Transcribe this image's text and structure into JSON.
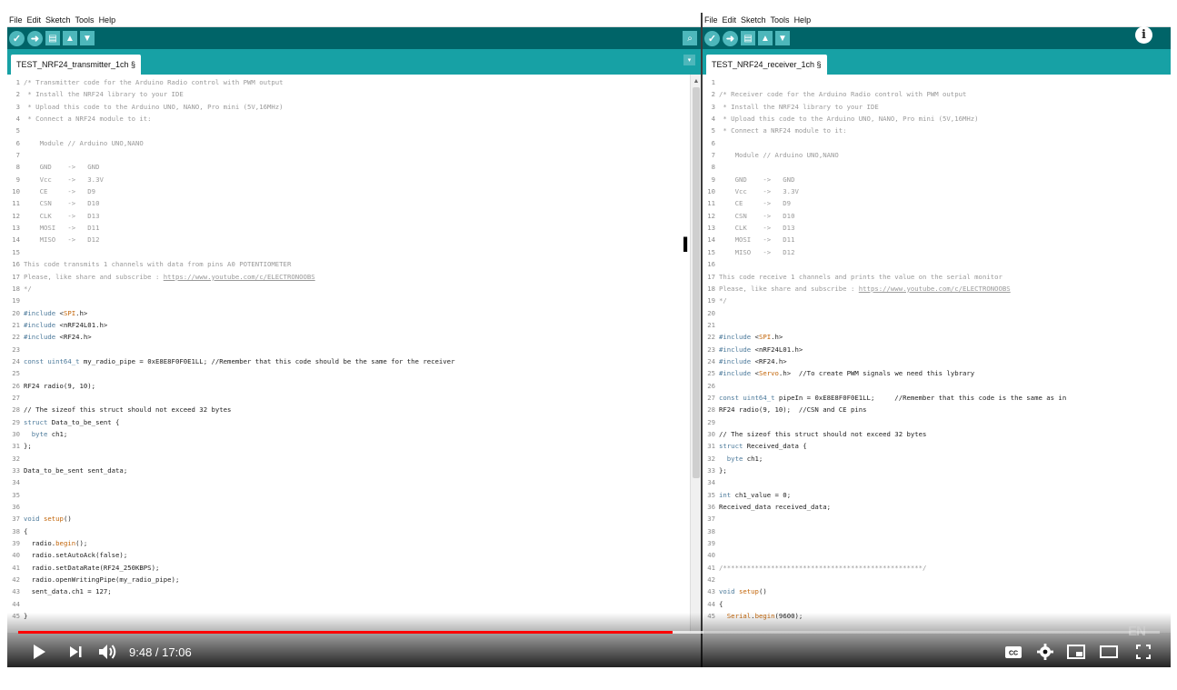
{
  "menu": [
    "File",
    "Edit",
    "Sketch",
    "Tools",
    "Help"
  ],
  "left_tab": "TEST_NRF24_transmitter_1ch §",
  "right_tab": "TEST_NRF24_receiver_1ch §",
  "left_code": [
    [
      [
        "cm",
        "/* Transmitter code for the Arduino Radio control with PWM output"
      ]
    ],
    [
      [
        "cm",
        " * Install the NRF24 library to your IDE"
      ]
    ],
    [
      [
        "cm",
        " * Upload this code to the Arduino UNO, NANO, Pro mini (5V,16MHz)"
      ]
    ],
    [
      [
        "cm",
        " * Connect a NRF24 module to it:"
      ]
    ],
    [
      [
        "cm",
        ""
      ]
    ],
    [
      [
        "cm",
        "    Module // Arduino UNO,NANO"
      ]
    ],
    [
      [
        "cm",
        ""
      ]
    ],
    [
      [
        "cm",
        "    GND    ->   GND"
      ]
    ],
    [
      [
        "cm",
        "    Vcc    ->   3.3V"
      ]
    ],
    [
      [
        "cm",
        "    CE     ->   D9"
      ]
    ],
    [
      [
        "cm",
        "    CSN    ->   D10"
      ]
    ],
    [
      [
        "cm",
        "    CLK    ->   D13"
      ]
    ],
    [
      [
        "cm",
        "    MOSI   ->   D11"
      ]
    ],
    [
      [
        "cm",
        "    MISO   ->   D12"
      ]
    ],
    [
      [
        "cm",
        ""
      ]
    ],
    [
      [
        "cm",
        "This code transmits 1 channels with data from pins A0 POTENTIOMETER"
      ]
    ],
    [
      [
        "cm",
        "Please, like share and subscribe : "
      ],
      [
        "url",
        "https://www.youtube.com/c/ELECTRONOOBS"
      ]
    ],
    [
      [
        "cm",
        "*/"
      ]
    ],
    [
      [
        "",
        ""
      ]
    ],
    [
      [
        "kw",
        "#include"
      ],
      [
        "",
        " <"
      ],
      [
        "fn",
        "SPI"
      ],
      [
        "",
        ".h>"
      ]
    ],
    [
      [
        "kw",
        "#include"
      ],
      [
        "",
        " <nRF24L01.h>"
      ]
    ],
    [
      [
        "kw",
        "#include"
      ],
      [
        "",
        " <RF24.h>"
      ]
    ],
    [
      [
        "",
        ""
      ]
    ],
    [
      [
        "kw",
        "const uint64_t"
      ],
      [
        "",
        " my_radio_pipe = 0xE8E8F0F0E1LL; //Remember that this code should be the same for the receiver"
      ]
    ],
    [
      [
        "",
        ""
      ]
    ],
    [
      [
        "",
        "RF24 radio(9, 10);"
      ]
    ],
    [
      [
        "",
        ""
      ]
    ],
    [
      [
        "",
        "// The sizeof this struct should not exceed 32 bytes"
      ]
    ],
    [
      [
        "kw",
        "struct"
      ],
      [
        "",
        " Data_to_be_sent {"
      ]
    ],
    [
      [
        "kw",
        "  byte"
      ],
      [
        "",
        " ch1;"
      ]
    ],
    [
      [
        "",
        "};"
      ]
    ],
    [
      [
        "",
        ""
      ]
    ],
    [
      [
        "",
        "Data_to_be_sent sent_data;"
      ]
    ],
    [
      [
        "",
        ""
      ]
    ],
    [
      [
        "",
        ""
      ]
    ],
    [
      [
        "",
        ""
      ]
    ],
    [
      [
        "kw",
        "void"
      ],
      [
        "",
        " "
      ],
      [
        "fn",
        "setup"
      ],
      [
        "",
        "()"
      ]
    ],
    [
      [
        "",
        "{"
      ]
    ],
    [
      [
        "",
        "  radio."
      ],
      [
        "fn",
        "begin"
      ],
      [
        "",
        "();"
      ]
    ],
    [
      [
        "",
        "  radio.setAutoAck(false);"
      ]
    ],
    [
      [
        "",
        "  radio.setDataRate(RF24_250KBPS);"
      ]
    ],
    [
      [
        "",
        "  radio.openWritingPipe(my_radio_pipe);"
      ]
    ],
    [
      [
        "",
        "  sent_data.ch1 = 127;"
      ]
    ],
    [
      [
        "",
        ""
      ]
    ],
    [
      [
        "",
        "}"
      ]
    ]
  ],
  "right_code": [
    [
      [
        "",
        ""
      ]
    ],
    [
      [
        "cm",
        "/* Receiver code for the Arduino Radio control with PWM output"
      ]
    ],
    [
      [
        "cm",
        " * Install the NRF24 library to your IDE"
      ]
    ],
    [
      [
        "cm",
        " * Upload this code to the Arduino UNO, NANO, Pro mini (5V,16MHz)"
      ]
    ],
    [
      [
        "cm",
        " * Connect a NRF24 module to it:"
      ]
    ],
    [
      [
        "cm",
        ""
      ]
    ],
    [
      [
        "cm",
        "    Module // Arduino UNO,NANO"
      ]
    ],
    [
      [
        "cm",
        ""
      ]
    ],
    [
      [
        "cm",
        "    GND    ->   GND"
      ]
    ],
    [
      [
        "cm",
        "    Vcc    ->   3.3V"
      ]
    ],
    [
      [
        "cm",
        "    CE     ->   D9"
      ]
    ],
    [
      [
        "cm",
        "    CSN    ->   D10"
      ]
    ],
    [
      [
        "cm",
        "    CLK    ->   D13"
      ]
    ],
    [
      [
        "cm",
        "    MOSI   ->   D11"
      ]
    ],
    [
      [
        "cm",
        "    MISO   ->   D12"
      ]
    ],
    [
      [
        "cm",
        ""
      ]
    ],
    [
      [
        "cm",
        "This code receive 1 channels and prints the value on the serial monitor"
      ]
    ],
    [
      [
        "cm",
        "Please, like share and subscribe : "
      ],
      [
        "url",
        "https://www.youtube.com/c/ELECTRONOOBS"
      ]
    ],
    [
      [
        "cm",
        "*/"
      ]
    ],
    [
      [
        "",
        ""
      ]
    ],
    [
      [
        "",
        ""
      ]
    ],
    [
      [
        "kw",
        "#include"
      ],
      [
        "",
        " <"
      ],
      [
        "fn",
        "SPI"
      ],
      [
        "",
        ".h>"
      ]
    ],
    [
      [
        "kw",
        "#include"
      ],
      [
        "",
        " <nRF24L01.h>"
      ]
    ],
    [
      [
        "kw",
        "#include"
      ],
      [
        "",
        " <RF24.h>"
      ]
    ],
    [
      [
        "kw",
        "#include"
      ],
      [
        "",
        " <"
      ],
      [
        "fn",
        "Servo"
      ],
      [
        "",
        ".h>  //To create PWM signals we need this lybrary"
      ]
    ],
    [
      [
        "",
        ""
      ]
    ],
    [
      [
        "kw",
        "const uint64_t"
      ],
      [
        "",
        " pipeIn = 0xE8E8F0F0E1LL;     //Remember that this code is the same as in"
      ]
    ],
    [
      [
        "",
        "RF24 radio(9, 10);  //CSN and CE pins"
      ]
    ],
    [
      [
        "",
        ""
      ]
    ],
    [
      [
        "",
        "// The sizeof this struct should not exceed 32 bytes"
      ]
    ],
    [
      [
        "kw",
        "struct"
      ],
      [
        "",
        " Received_data {"
      ]
    ],
    [
      [
        "kw",
        "  byte"
      ],
      [
        "",
        " ch1;"
      ]
    ],
    [
      [
        "",
        "};"
      ]
    ],
    [
      [
        "",
        ""
      ]
    ],
    [
      [
        "kw",
        "int"
      ],
      [
        "",
        " ch1_value = 0;"
      ]
    ],
    [
      [
        "",
        "Received_data received_data;"
      ]
    ],
    [
      [
        "",
        ""
      ]
    ],
    [
      [
        "",
        ""
      ]
    ],
    [
      [
        "",
        ""
      ]
    ],
    [
      [
        "",
        ""
      ]
    ],
    [
      [
        "cm",
        "/**************************************************/"
      ]
    ],
    [
      [
        "",
        ""
      ]
    ],
    [
      [
        "kw",
        "void"
      ],
      [
        "",
        " "
      ],
      [
        "fn",
        "setup"
      ],
      [
        "",
        "()"
      ]
    ],
    [
      [
        "",
        "{"
      ]
    ],
    [
      [
        "fn",
        "  Serial"
      ],
      [
        "",
        "."
      ],
      [
        "fn",
        "begin"
      ],
      [
        "",
        "(9600);"
      ]
    ]
  ],
  "player": {
    "time": "9:48 / 17:06",
    "progress": 0.573,
    "buffered": 0.6,
    "progress_color": "#ff0000"
  },
  "icons": {
    "play": "play-icon",
    "next": "next-icon",
    "volume": "volume-icon",
    "captions": "captions-icon",
    "settings": "settings-icon",
    "miniplayer": "miniplayer-icon",
    "theater": "theater-icon",
    "fullscreen": "fullscreen-icon",
    "info": "info-icon"
  },
  "colors": {
    "toolbar": "#006468",
    "tabbar": "#17a1a5",
    "button": "#4db7bb"
  }
}
